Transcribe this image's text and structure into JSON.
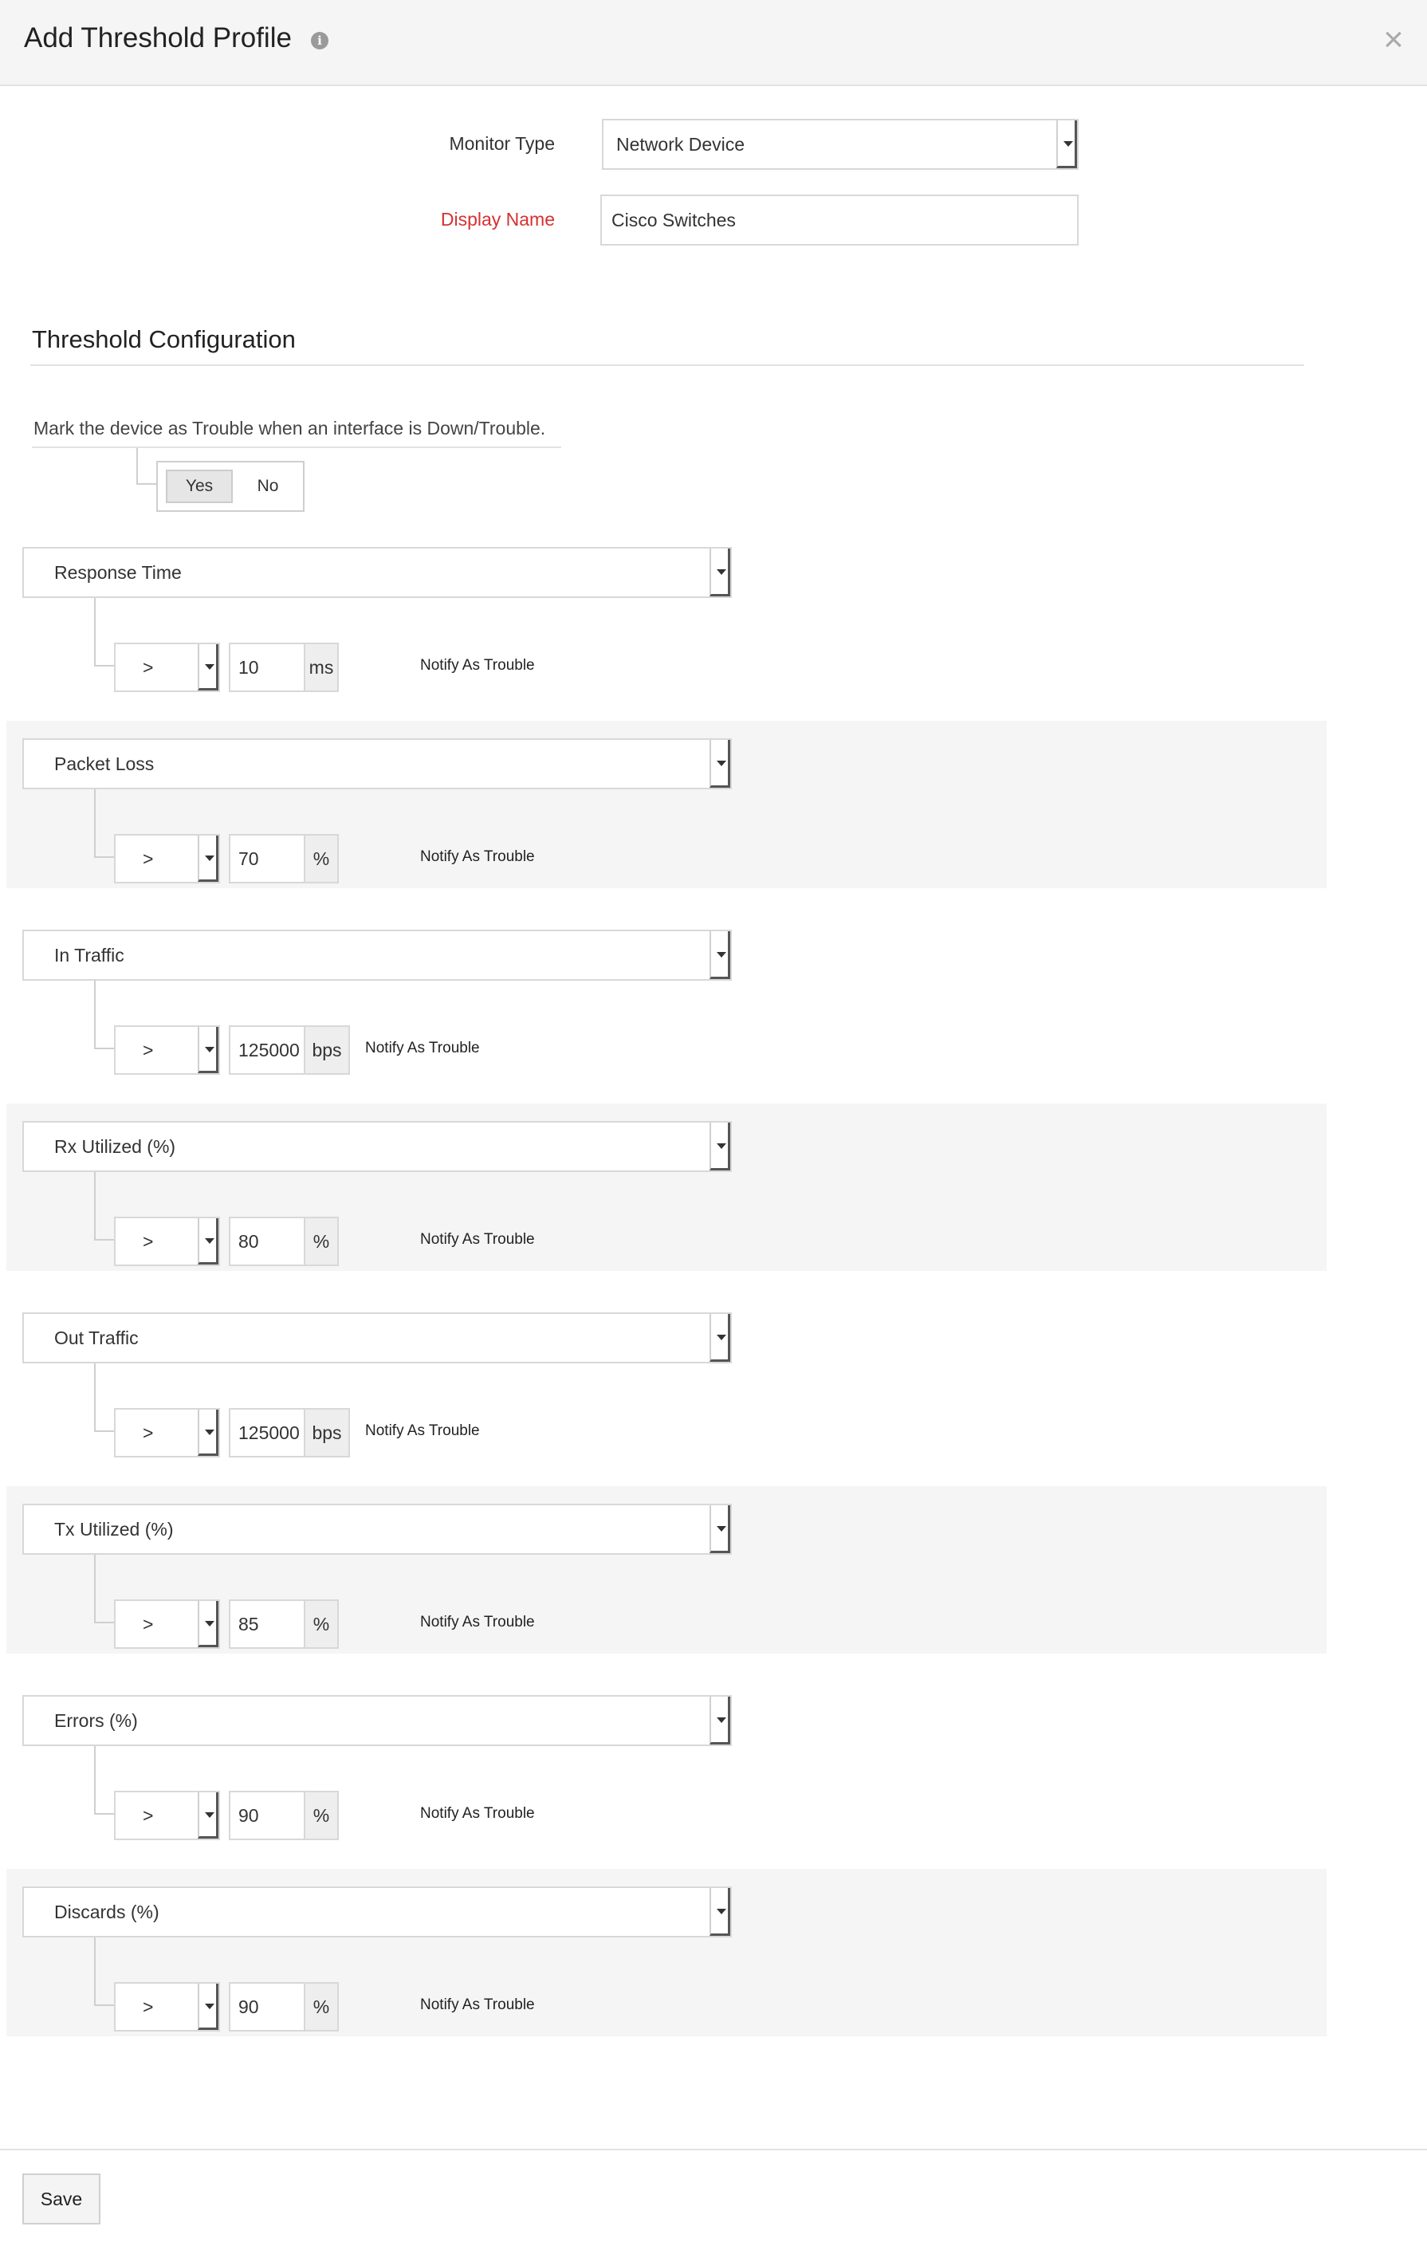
{
  "header": {
    "title": "Add Threshold Profile",
    "info_icon": "info-icon",
    "close_symbol": "×"
  },
  "form": {
    "monitor_type_label": "Monitor Type",
    "monitor_type_value": "Network Device",
    "display_name_label": "Display Name",
    "display_name_value": "Cisco Switches"
  },
  "threshold": {
    "section_title": "Threshold Configuration",
    "mark_text": "Mark the device as Trouble when an interface is Down/Trouble.",
    "toggle_yes": "Yes",
    "toggle_no": "No",
    "toggle_selected": "Yes"
  },
  "metrics": [
    {
      "name": "Response Time",
      "operator": ">",
      "value": "10",
      "unit": "ms",
      "notify": "Notify As Trouble"
    },
    {
      "name": "Packet Loss",
      "operator": ">",
      "value": "70",
      "unit": "%",
      "notify": "Notify As Trouble"
    },
    {
      "name": "In Traffic",
      "operator": ">",
      "value": "125000",
      "unit": "bps",
      "notify": "Notify As Trouble"
    },
    {
      "name": "Rx Utilized (%)",
      "operator": ">",
      "value": "80",
      "unit": "%",
      "notify": "Notify As Trouble"
    },
    {
      "name": "Out Traffic",
      "operator": ">",
      "value": "125000",
      "unit": "bps",
      "notify": "Notify As Trouble"
    },
    {
      "name": "Tx Utilized (%)",
      "operator": ">",
      "value": "85",
      "unit": "%",
      "notify": "Notify As Trouble"
    },
    {
      "name": "Errors (%)",
      "operator": ">",
      "value": "90",
      "unit": "%",
      "notify": "Notify As Trouble"
    },
    {
      "name": "Discards (%)",
      "operator": ">",
      "value": "90",
      "unit": "%",
      "notify": "Notify As Trouble"
    }
  ],
  "footer": {
    "save_label": "Save"
  },
  "colors": {
    "required_label": "#d63131",
    "shaded_row": "#f5f5f5",
    "header_bg": "#f5f5f5"
  }
}
